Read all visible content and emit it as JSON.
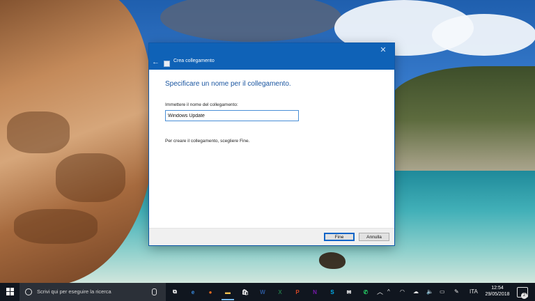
{
  "dialog": {
    "title": "Crea collegamento",
    "close_glyph": "✕",
    "back_glyph": "←",
    "heading": "Specificare un nome per il collegamento.",
    "field_label": "Immettere il nome del collegamento:",
    "field_value": "Windows Update",
    "instruction": "Per creare il collegamento, scegliere Fine.",
    "finish_label": "Fine",
    "cancel_label": "Annulla"
  },
  "taskbar": {
    "search_placeholder": "Scrivi qui per eseguire la ricerca",
    "apps": [
      {
        "name": "task-view",
        "glyph": "⧉",
        "color": "#ffffff"
      },
      {
        "name": "edge",
        "glyph": "e",
        "color": "#3a8ee6"
      },
      {
        "name": "firefox",
        "glyph": "●",
        "color": "#f06b1e"
      },
      {
        "name": "file-explorer",
        "glyph": "▬",
        "color": "#f2c14e"
      },
      {
        "name": "store",
        "glyph": "🛍",
        "color": "#ffffff"
      },
      {
        "name": "word",
        "glyph": "W",
        "color": "#2b579a"
      },
      {
        "name": "excel",
        "glyph": "X",
        "color": "#217346"
      },
      {
        "name": "powerpoint",
        "glyph": "P",
        "color": "#d24726"
      },
      {
        "name": "onenote",
        "glyph": "N",
        "color": "#7719aa"
      },
      {
        "name": "skype",
        "glyph": "S",
        "color": "#00aff0"
      },
      {
        "name": "mail",
        "glyph": "✉",
        "color": "#ffffff"
      },
      {
        "name": "whatsapp",
        "glyph": "✆",
        "color": "#25d366"
      }
    ],
    "tray": {
      "chevron": "︿",
      "language": "ITA",
      "time": "12:54",
      "date": "29/05/2018",
      "notifications": "2"
    }
  }
}
